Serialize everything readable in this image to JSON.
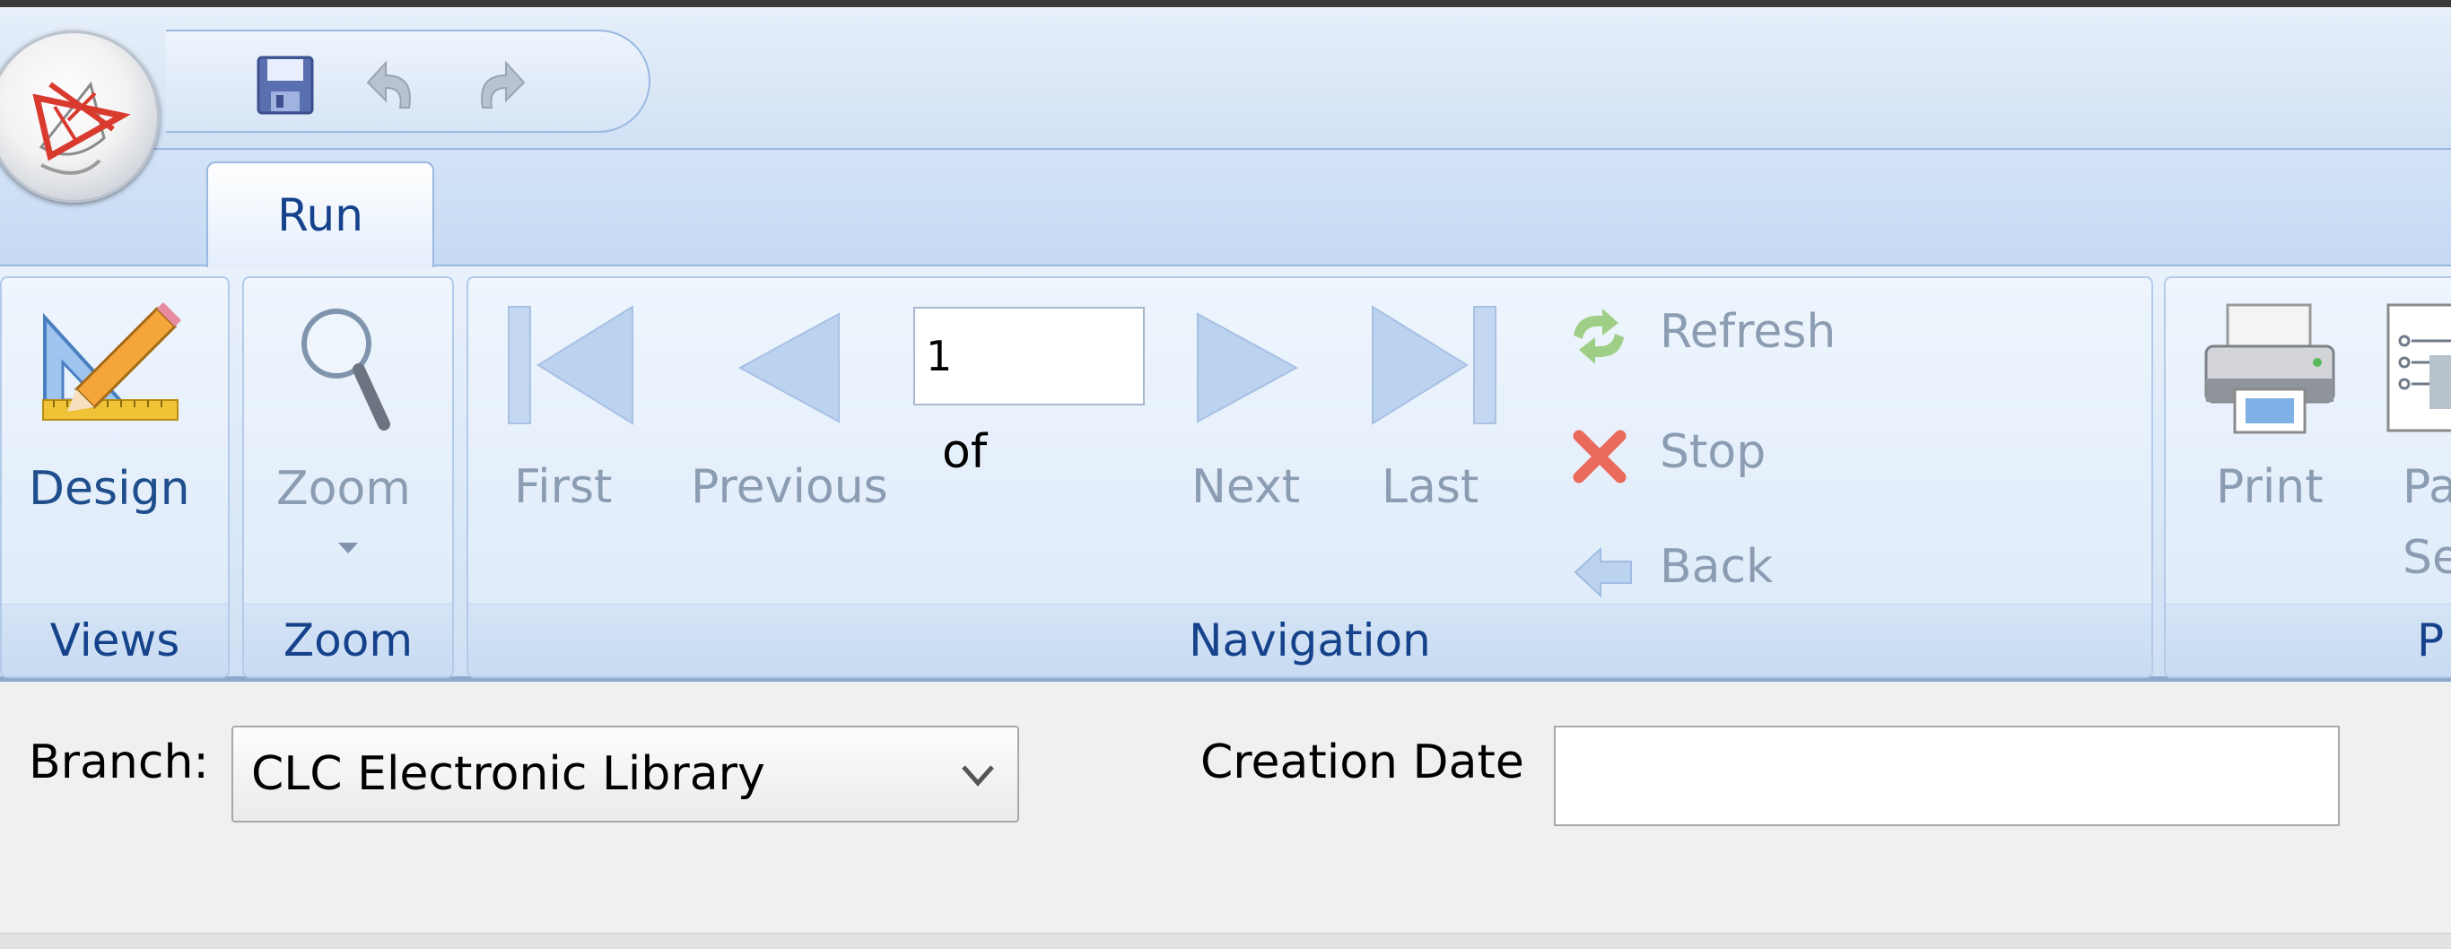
{
  "ribbon": {
    "tabs": [
      {
        "label": "Run"
      }
    ],
    "groups": {
      "views": {
        "label": "Views",
        "design_label": "Design"
      },
      "zoom": {
        "label": "Zoom",
        "zoom_label": "Zoom"
      },
      "navigation": {
        "label": "Navigation",
        "first_label": "First",
        "previous_label": "Previous",
        "page_value": "1",
        "of_label": "of",
        "next_label": "Next",
        "last_label": "Last",
        "refresh_label": "Refresh",
        "stop_label": "Stop",
        "back_label": "Back"
      },
      "print": {
        "label": "P",
        "print_label": "Print",
        "page_setup_line1": "Pa",
        "page_setup_line2": "Se"
      }
    }
  },
  "params": {
    "branch_label": "Branch:",
    "branch_value": "CLC Electronic Library",
    "creation_date_label": "Creation Date",
    "creation_date_value": ""
  },
  "colors": {
    "accent": "#15428b",
    "ribbon_bg": "#dbe8f8",
    "stop_red": "#e0392b"
  },
  "icons": [
    "app-menu-icon",
    "save-icon",
    "undo-icon",
    "redo-icon",
    "design-icon",
    "magnifier-icon",
    "first-page-icon",
    "previous-page-icon",
    "next-page-icon",
    "last-page-icon",
    "refresh-icon",
    "stop-icon",
    "back-icon",
    "printer-icon",
    "page-setup-icon",
    "chevron-down-icon"
  ]
}
